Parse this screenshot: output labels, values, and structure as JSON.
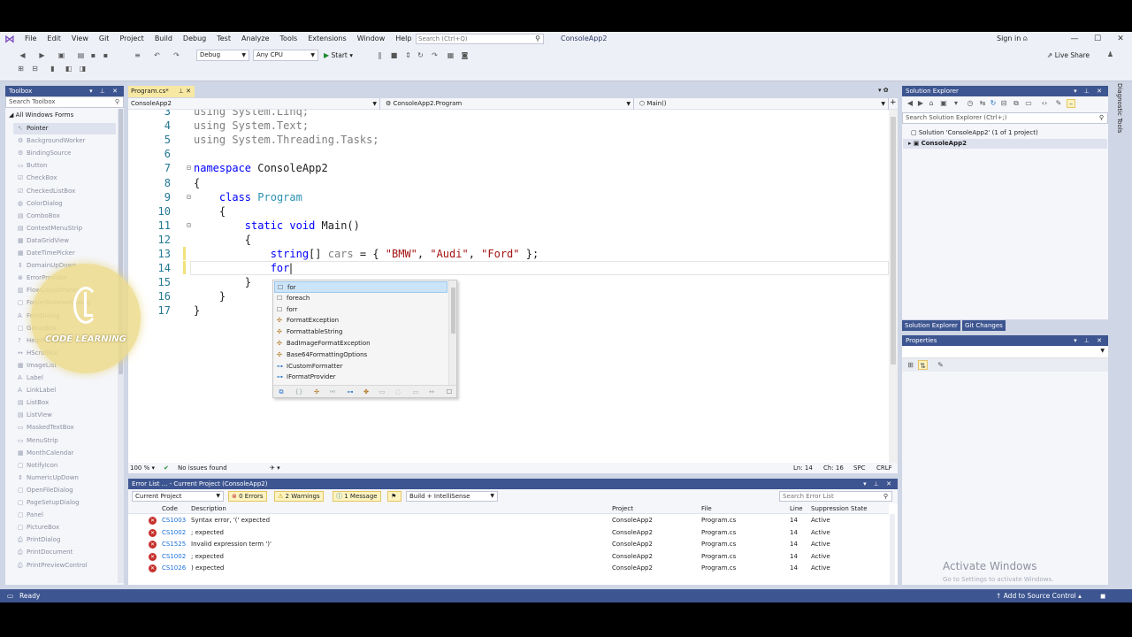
{
  "menu": {
    "items": [
      "File",
      "Edit",
      "View",
      "Git",
      "Project",
      "Build",
      "Debug",
      "Test",
      "Analyze",
      "Tools",
      "Extensions",
      "Window",
      "Help"
    ],
    "search_placeholder": "Search (Ctrl+Q)",
    "project_title": "ConsoleApp2",
    "sign_in": "Sign in"
  },
  "toolbar": {
    "config": "Debug",
    "platform": "Any CPU",
    "start": "Start",
    "live_share": "Live Share"
  },
  "toolbox": {
    "title": "Toolbox",
    "search_placeholder": "Search Toolbox",
    "group": "All Windows Forms",
    "items": [
      "Pointer",
      "BackgroundWorker",
      "BindingSource",
      "Button",
      "CheckBox",
      "CheckedListBox",
      "ColorDialog",
      "ComboBox",
      "ContextMenuStrip",
      "DataGridView",
      "DateTimePicker",
      "DomainUpDown",
      "ErrorProvider",
      "FlowLayoutPanel",
      "FolderBrowserDialog",
      "FontDialog",
      "GroupBox",
      "HelpProvider",
      "HScrollBar",
      "ImageList",
      "Label",
      "LinkLabel",
      "ListBox",
      "ListView",
      "MaskedTextBox",
      "MenuStrip",
      "MonthCalendar",
      "NotifyIcon",
      "NumericUpDown",
      "OpenFileDialog",
      "PageSetupDialog",
      "Panel",
      "PictureBox",
      "PrintDialog",
      "PrintDocument",
      "PrintPreviewControl"
    ]
  },
  "watermark": {
    "text": "CODE LEARNING"
  },
  "editor": {
    "tab": "Program.cs*",
    "nav_project": "ConsoleApp2",
    "nav_class": "ConsoleApp2.Program",
    "nav_member": "Main()",
    "lines": [
      {
        "num": "3",
        "parts": [
          {
            "t": "using System.Linq;",
            "c": "gray"
          }
        ]
      },
      {
        "num": "4",
        "parts": [
          {
            "t": "using System.Text;",
            "c": "gray"
          }
        ]
      },
      {
        "num": "5",
        "parts": [
          {
            "t": "using System.Threading.Tasks;",
            "c": "gray"
          }
        ]
      },
      {
        "num": "6",
        "parts": []
      },
      {
        "num": "7",
        "parts": [
          {
            "t": "namespace",
            "c": "kw"
          },
          {
            "t": " ConsoleApp2",
            "c": ""
          }
        ]
      },
      {
        "num": "8",
        "parts": [
          {
            "t": "{",
            "c": ""
          }
        ]
      },
      {
        "num": "9",
        "parts": [
          {
            "t": "    class",
            "c": "kw"
          },
          {
            "t": " ",
            "c": ""
          },
          {
            "t": "Program",
            "c": "ty"
          }
        ]
      },
      {
        "num": "10",
        "parts": [
          {
            "t": "    {",
            "c": ""
          }
        ]
      },
      {
        "num": "11",
        "parts": [
          {
            "t": "        static",
            "c": "kw"
          },
          {
            "t": " ",
            "c": ""
          },
          {
            "t": "void",
            "c": "kw"
          },
          {
            "t": " Main()",
            "c": ""
          }
        ]
      },
      {
        "num": "12",
        "parts": [
          {
            "t": "        {",
            "c": ""
          }
        ]
      },
      {
        "num": "13",
        "parts": [
          {
            "t": "            string",
            "c": "kw"
          },
          {
            "t": "[] ",
            "c": ""
          },
          {
            "t": "cars",
            "c": "gray"
          },
          {
            "t": " = { ",
            "c": ""
          },
          {
            "t": "\"BMW\"",
            "c": "str"
          },
          {
            "t": ", ",
            "c": ""
          },
          {
            "t": "\"Audi\"",
            "c": "str"
          },
          {
            "t": ", ",
            "c": ""
          },
          {
            "t": "\"Ford\"",
            "c": "str"
          },
          {
            "t": " };",
            "c": ""
          }
        ]
      },
      {
        "num": "14",
        "parts": [
          {
            "t": "            for",
            "c": "kw"
          }
        ]
      },
      {
        "num": "15",
        "parts": [
          {
            "t": "        }",
            "c": ""
          }
        ]
      },
      {
        "num": "16",
        "parts": [
          {
            "t": "    }",
            "c": ""
          }
        ]
      },
      {
        "num": "17",
        "parts": [
          {
            "t": "}",
            "c": ""
          }
        ]
      }
    ],
    "zoom": "100 %",
    "issues": "No issues found",
    "ln": "Ln: 14",
    "ch": "Ch: 16",
    "spc": "SPC",
    "crlf": "CRLF"
  },
  "completion": {
    "items": [
      {
        "label": "for",
        "kind": "snippet"
      },
      {
        "label": "foreach",
        "kind": "snippet"
      },
      {
        "label": "forr",
        "kind": "snippet"
      },
      {
        "label": "FormatException",
        "kind": "class"
      },
      {
        "label": "FormattableString",
        "kind": "class"
      },
      {
        "label": "BadImageFormatException",
        "kind": "class"
      },
      {
        "label": "Base64FormattingOptions",
        "kind": "class"
      },
      {
        "label": "ICustomFormatter",
        "kind": "interface"
      },
      {
        "label": "IFormatProvider",
        "kind": "interface"
      }
    ]
  },
  "error_list": {
    "title": "Error List ... - Current Project (ConsoleApp2)",
    "scope": "Current Project",
    "errors": "0 Errors",
    "warnings": "2 Warnings",
    "messages": "1 Message",
    "build_filter": "Build + IntelliSense",
    "search_placeholder": "Search Error List",
    "headers": {
      "code": "Code",
      "description": "Description",
      "project": "Project",
      "file": "File",
      "line": "Line",
      "state": "Suppression State"
    },
    "rows": [
      {
        "code": "CS1003",
        "description": "Syntax error, '(' expected",
        "project": "ConsoleApp2",
        "file": "Program.cs",
        "line": "14",
        "state": "Active"
      },
      {
        "code": "CS1002",
        "description": "; expected",
        "project": "ConsoleApp2",
        "file": "Program.cs",
        "line": "14",
        "state": "Active"
      },
      {
        "code": "CS1525",
        "description": "Invalid expression term ')'",
        "project": "ConsoleApp2",
        "file": "Program.cs",
        "line": "14",
        "state": "Active"
      },
      {
        "code": "CS1002",
        "description": "; expected",
        "project": "ConsoleApp2",
        "file": "Program.cs",
        "line": "14",
        "state": "Active"
      },
      {
        "code": "CS1026",
        "description": ") expected",
        "project": "ConsoleApp2",
        "file": "Program.cs",
        "line": "14",
        "state": "Active"
      }
    ]
  },
  "solution": {
    "title": "Solution Explorer",
    "search_placeholder": "Search Solution Explorer (Ctrl+;)",
    "solution_node": "Solution 'ConsoleApp2' (1 of 1 project)",
    "project_node": "ConsoleApp2",
    "tab_solution": "Solution Explorer",
    "tab_git": "Git Changes"
  },
  "properties": {
    "title": "Properties"
  },
  "side_strip": "Diagnostic Tools",
  "activate": {
    "title": "Activate Windows",
    "subtitle": "Go to Settings to activate Windows."
  },
  "status": {
    "ready": "Ready",
    "source_control": "Add to Source Control"
  }
}
